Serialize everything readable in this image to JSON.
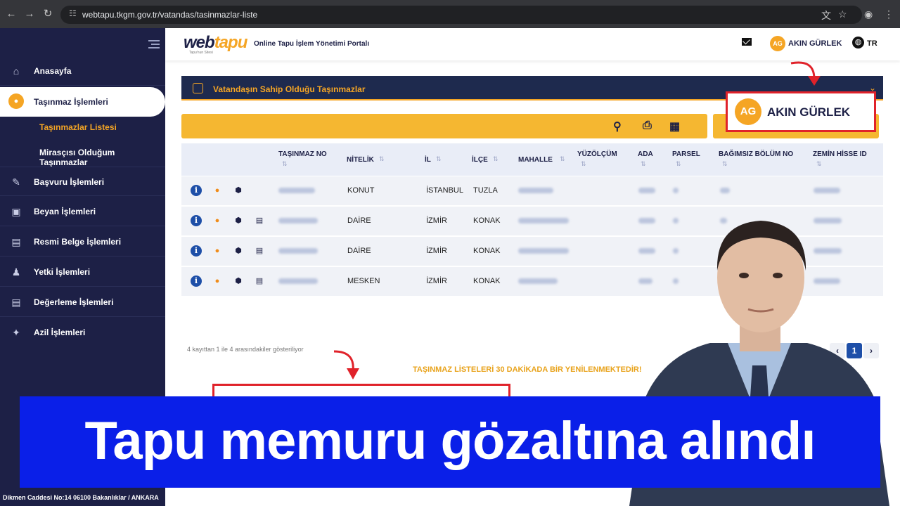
{
  "browser": {
    "url": "webtapu.tkgm.gov.tr/vatandas/tasinmazlar-liste"
  },
  "sidebar": {
    "items": [
      {
        "label": "Anasayfa",
        "icon": "home-icon"
      },
      {
        "label": "Taşınmaz İşlemleri",
        "icon": "location-pin-icon",
        "active": true
      },
      {
        "label": "Başvuru İşlemleri",
        "icon": "pen-icon"
      },
      {
        "label": "Beyan İşlemleri",
        "icon": "lock-icon"
      },
      {
        "label": "Resmi Belge İşlemleri",
        "icon": "document-icon"
      },
      {
        "label": "Yetki İşlemleri",
        "icon": "user-icon"
      },
      {
        "label": "Değerleme İşlemleri",
        "icon": "document-icon"
      },
      {
        "label": "Azil İşlemleri",
        "icon": "brush-icon"
      }
    ],
    "subitems": [
      {
        "label": "Taşınmazlar Listesi",
        "active": true
      },
      {
        "label": "Mirasçısı Olduğum Taşınmazlar",
        "active": false
      }
    ],
    "footer_address": "Dikmen Caddesi No:14 06100 Bakanlıklar / ANKARA"
  },
  "header": {
    "logo_web": "web",
    "logo_tapu": "tapu",
    "logo_sub": "Tapu'nun Sitesi",
    "portal_title": "Online Tapu İşlem Yönetimi Portalı",
    "user_initials": "AG",
    "user_name": "AKIN GÜRLEK",
    "language": "TR"
  },
  "panel": {
    "title": "Vatandaşın Sahip Olduğu Taşınmazlar"
  },
  "table": {
    "columns": [
      "TAŞINMAZ NO",
      "NİTELİK",
      "İL",
      "İLÇE",
      "MAHALLE",
      "YÜZÖLÇÜM",
      "ADA",
      "PARSEL",
      "BAĞIMSIZ BÖLÜM NO",
      "ZEMİN HİSSE ID"
    ],
    "rows": [
      {
        "nitelik": "KONUT",
        "il": "İSTANBUL",
        "ilce": "TUZLA"
      },
      {
        "nitelik": "DAİRE",
        "il": "İZMİR",
        "ilce": "KONAK"
      },
      {
        "nitelik": "DAİRE",
        "il": "İZMİR",
        "ilce": "KONAK"
      },
      {
        "nitelik": "MESKEN",
        "il": "İZMİR",
        "ilce": "KONAK"
      }
    ]
  },
  "listing_info": "4 kayıttan 1 ile 4 arasındakiler gösteriliyor",
  "notice": "TAŞINMAZ LİSTELERİ 30 DAKİKADA BİR YENİLENMEKTEDİR!",
  "pagination": {
    "current_page": "1"
  },
  "highlight": {
    "initials": "AG",
    "name": "AKIN GÜRLEK"
  },
  "headline": "Tapu memuru gözaltına alındı",
  "colors": {
    "sidebar_bg": "#1d2046",
    "accent": "#f5a524",
    "banner_bg": "#0a1fe8",
    "highlight_red": "#e0222a"
  }
}
